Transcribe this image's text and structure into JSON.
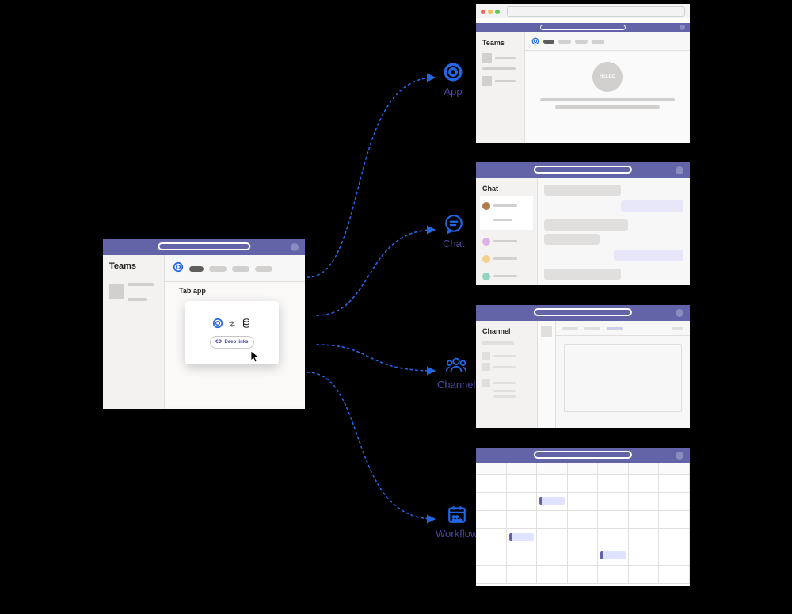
{
  "source": {
    "sidebar_title": "Teams",
    "tab_app_label": "Tab app",
    "deep_link_label": "Deep links"
  },
  "destinations": {
    "app": {
      "label": "App",
      "window_title": "Teams",
      "hello": "HELLO"
    },
    "chat": {
      "label": "Chat",
      "window_title": "Chat"
    },
    "channel": {
      "label": "Channel",
      "window_title": "Channel"
    },
    "workflow": {
      "label": "Workflow"
    }
  },
  "colors": {
    "purple": "#6264a7",
    "blue": "#2266e3"
  }
}
